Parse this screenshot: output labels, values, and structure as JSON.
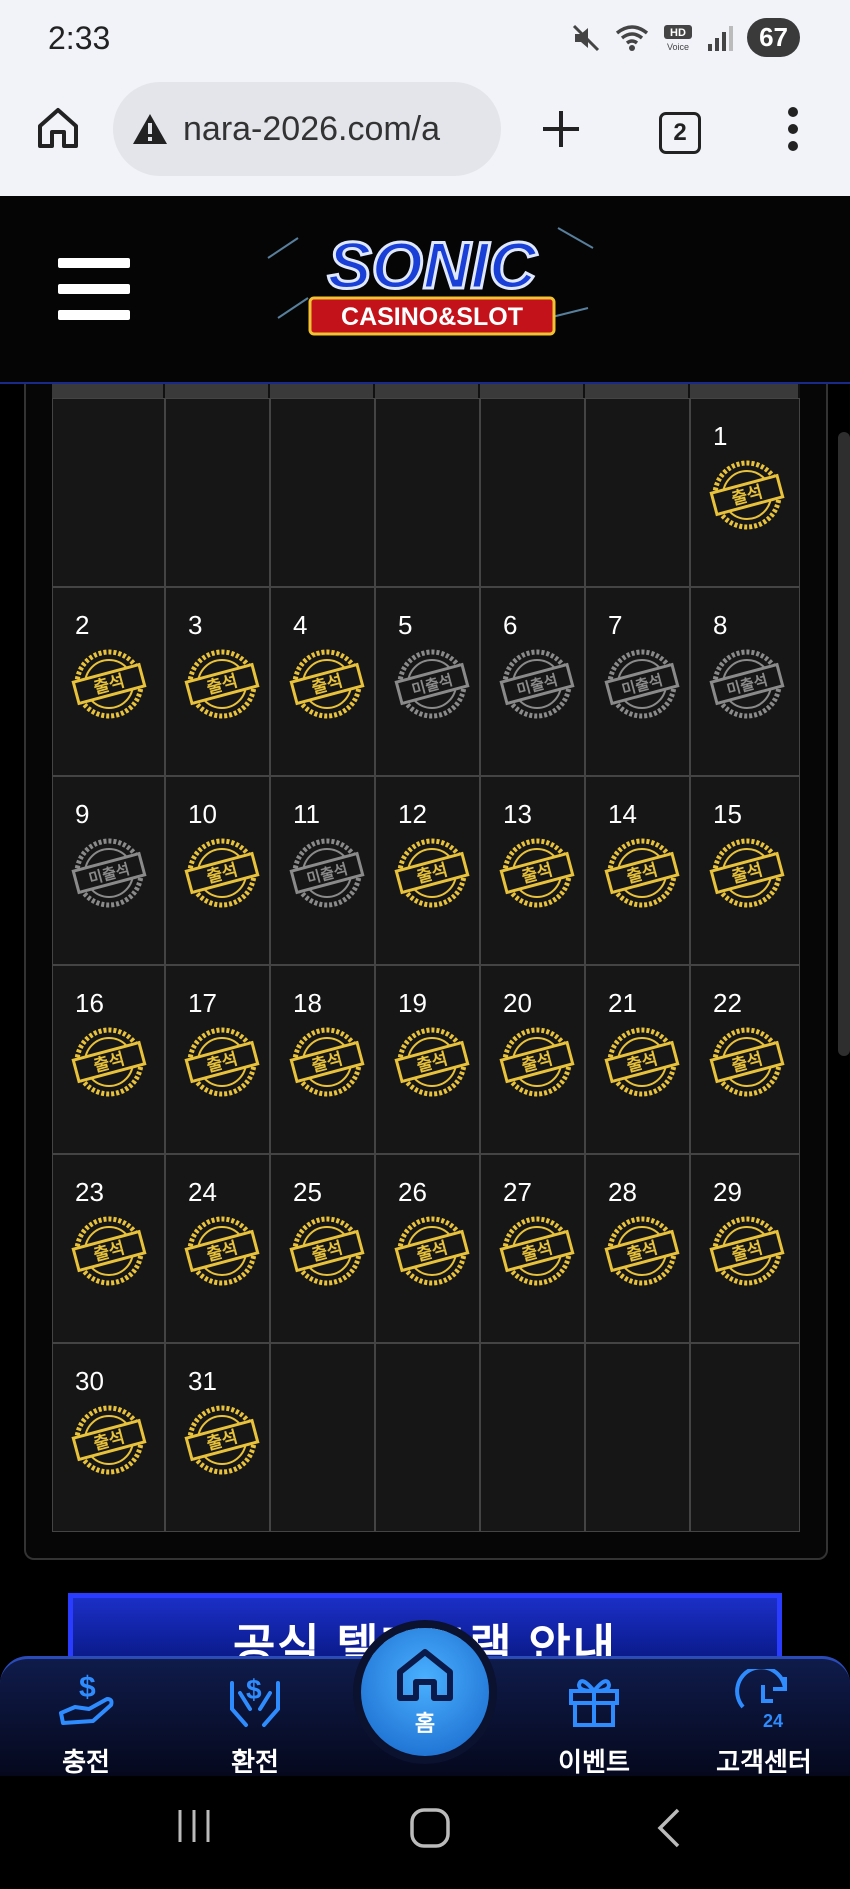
{
  "status_bar": {
    "time": "2:33",
    "battery": "67",
    "hd_voice": "HD Voice"
  },
  "browser": {
    "url": "nara-2026.com/a",
    "tab_count": "2"
  },
  "site": {
    "logo_top": "SONIC",
    "logo_bottom": "CASINO&SLOT"
  },
  "calendar": {
    "attended_label": "출석",
    "missed_label": "미출석",
    "weeks": [
      [
        null,
        null,
        null,
        null,
        null,
        null,
        {
          "day": "1",
          "status": "attended"
        }
      ],
      [
        {
          "day": "2",
          "status": "attended"
        },
        {
          "day": "3",
          "status": "attended"
        },
        {
          "day": "4",
          "status": "attended"
        },
        {
          "day": "5",
          "status": "missed"
        },
        {
          "day": "6",
          "status": "missed"
        },
        {
          "day": "7",
          "status": "missed"
        },
        {
          "day": "8",
          "status": "missed"
        }
      ],
      [
        {
          "day": "9",
          "status": "missed"
        },
        {
          "day": "10",
          "status": "attended"
        },
        {
          "day": "11",
          "status": "missed"
        },
        {
          "day": "12",
          "status": "attended"
        },
        {
          "day": "13",
          "status": "attended"
        },
        {
          "day": "14",
          "status": "attended"
        },
        {
          "day": "15",
          "status": "attended"
        }
      ],
      [
        {
          "day": "16",
          "status": "attended"
        },
        {
          "day": "17",
          "status": "attended"
        },
        {
          "day": "18",
          "status": "attended"
        },
        {
          "day": "19",
          "status": "attended"
        },
        {
          "day": "20",
          "status": "attended"
        },
        {
          "day": "21",
          "status": "attended"
        },
        {
          "day": "22",
          "status": "attended"
        }
      ],
      [
        {
          "day": "23",
          "status": "attended"
        },
        {
          "day": "24",
          "status": "attended"
        },
        {
          "day": "25",
          "status": "attended"
        },
        {
          "day": "26",
          "status": "attended"
        },
        {
          "day": "27",
          "status": "attended"
        },
        {
          "day": "28",
          "status": "attended"
        },
        {
          "day": "29",
          "status": "attended"
        }
      ],
      [
        {
          "day": "30",
          "status": "attended"
        },
        {
          "day": "31",
          "status": "attended"
        },
        null,
        null,
        null,
        null,
        null
      ]
    ]
  },
  "banner": {
    "text": "공식 텔레그램 안내"
  },
  "bottom_nav": {
    "deposit": "충전",
    "withdraw": "환전",
    "home": "홈",
    "event": "이벤트",
    "support": "고객센터"
  },
  "colors": {
    "gold": "#e8c23a",
    "missed": "#8a8a8a",
    "nav_blue": "#2f8cff"
  }
}
